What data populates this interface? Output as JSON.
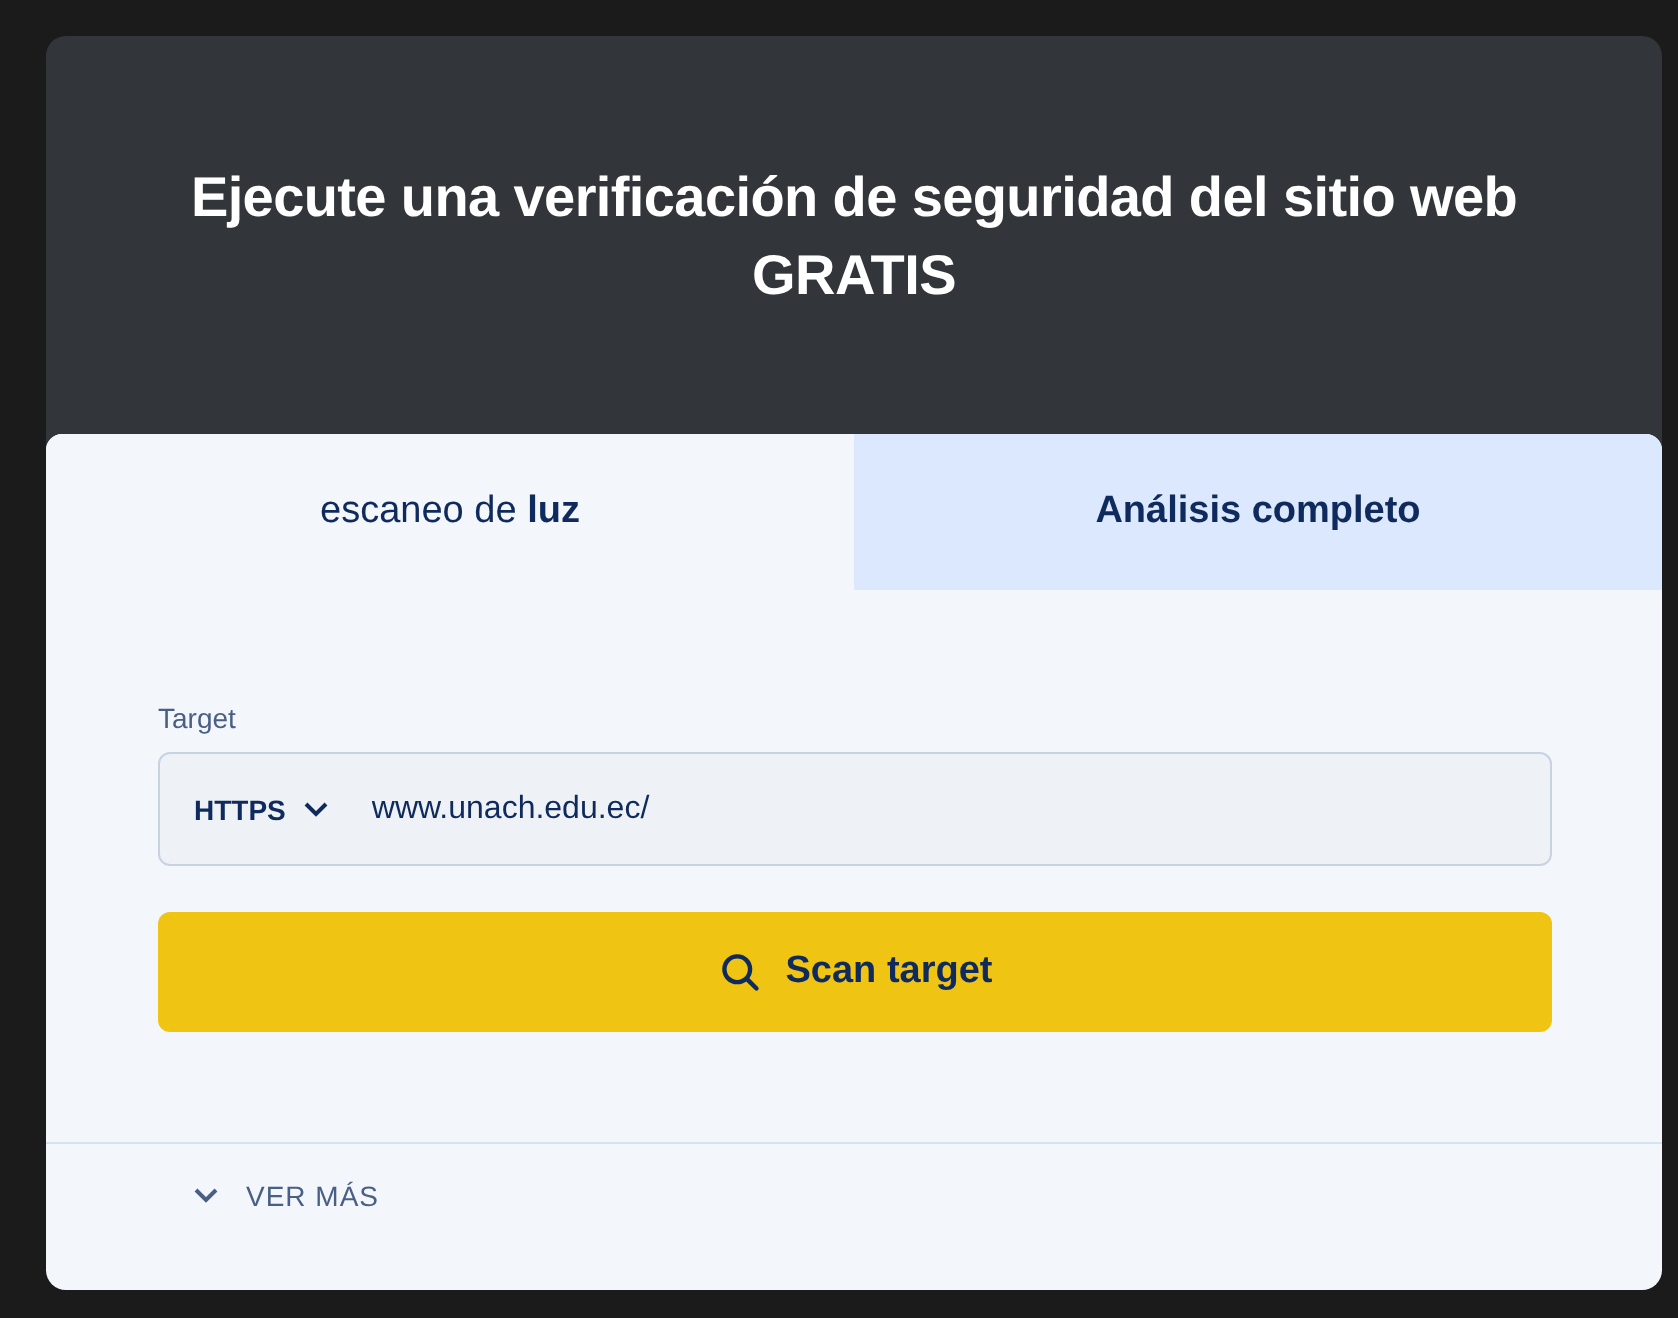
{
  "header": {
    "title": "Ejecute una verificación de seguridad del sitio web GRATIS"
  },
  "tabs": [
    {
      "label": "escaneo de **luz**",
      "selected": true
    },
    {
      "label": "Análisis completo",
      "selected": false
    }
  ],
  "form": {
    "label": "Target",
    "protocol": "HTTPS",
    "value": "www.unach.edu.ec/"
  },
  "scan_button": "Scan target",
  "more": {
    "label": "VER MÁS",
    "expanded": false
  }
}
